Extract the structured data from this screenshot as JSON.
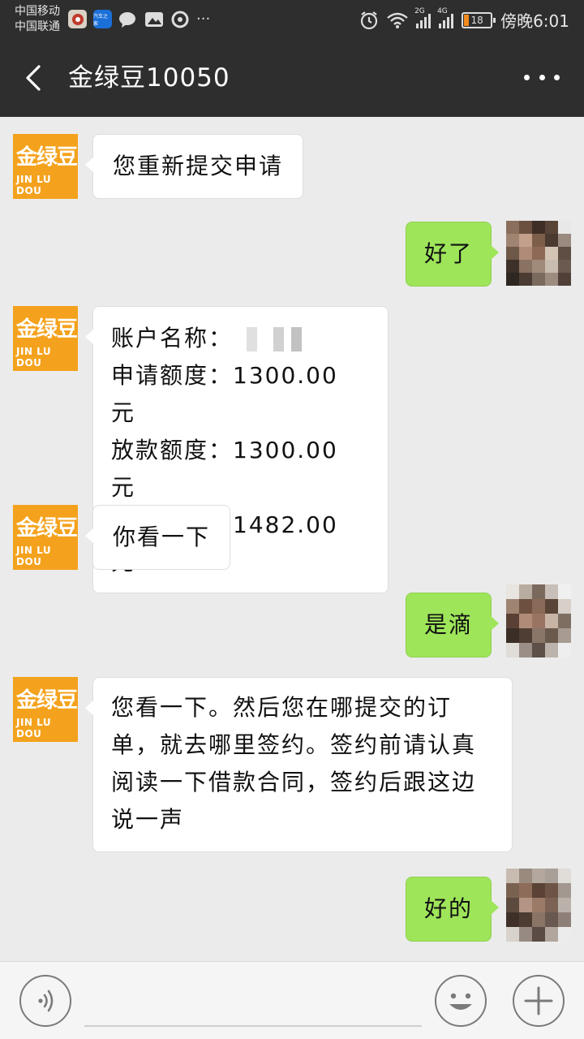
{
  "status_bar": {
    "carrier_1": "中国移动",
    "carrier_2": "中国联通",
    "app_icon_2_text": "汽车之家",
    "more_notifications": "···",
    "net_1": "2G",
    "net_2": "4G",
    "battery": "18",
    "time": "傍晚6:01"
  },
  "header": {
    "title": "金绿豆10050"
  },
  "brand_avatar": {
    "line1": "金绿豆",
    "line2": "JIN LU DOU"
  },
  "messages": [
    {
      "side": "left",
      "text": "您重新提交申请"
    },
    {
      "side": "right",
      "text": "好了"
    },
    {
      "side": "left",
      "account_label": "账户名称：",
      "lines": [
        "申请额度：1300.00 元",
        "放款额度：1300.00 元",
        "应收总额：1482.00 元"
      ]
    },
    {
      "side": "left",
      "text": "你看一下"
    },
    {
      "side": "right",
      "text": "是滴"
    },
    {
      "side": "left",
      "lines": [
        "您看一下。然后您在哪提交的订",
        "单，就去哪里签约。签约前请认真",
        "阅读一下借款合同，签约后跟这边",
        "说一声"
      ]
    },
    {
      "side": "right",
      "text": "好的"
    }
  ],
  "colors": {
    "header_bg": "#2e2e2e",
    "chat_bg": "#ebebeb",
    "outgoing_bubble": "#9ee55a",
    "incoming_bubble": "#ffffff",
    "brand_orange": "#f4a21d"
  },
  "icons": {
    "back": "chevron-left-icon",
    "more": "more-dots-icon",
    "voice": "voice-icon",
    "emoji": "smiley-icon",
    "plus": "plus-icon"
  }
}
